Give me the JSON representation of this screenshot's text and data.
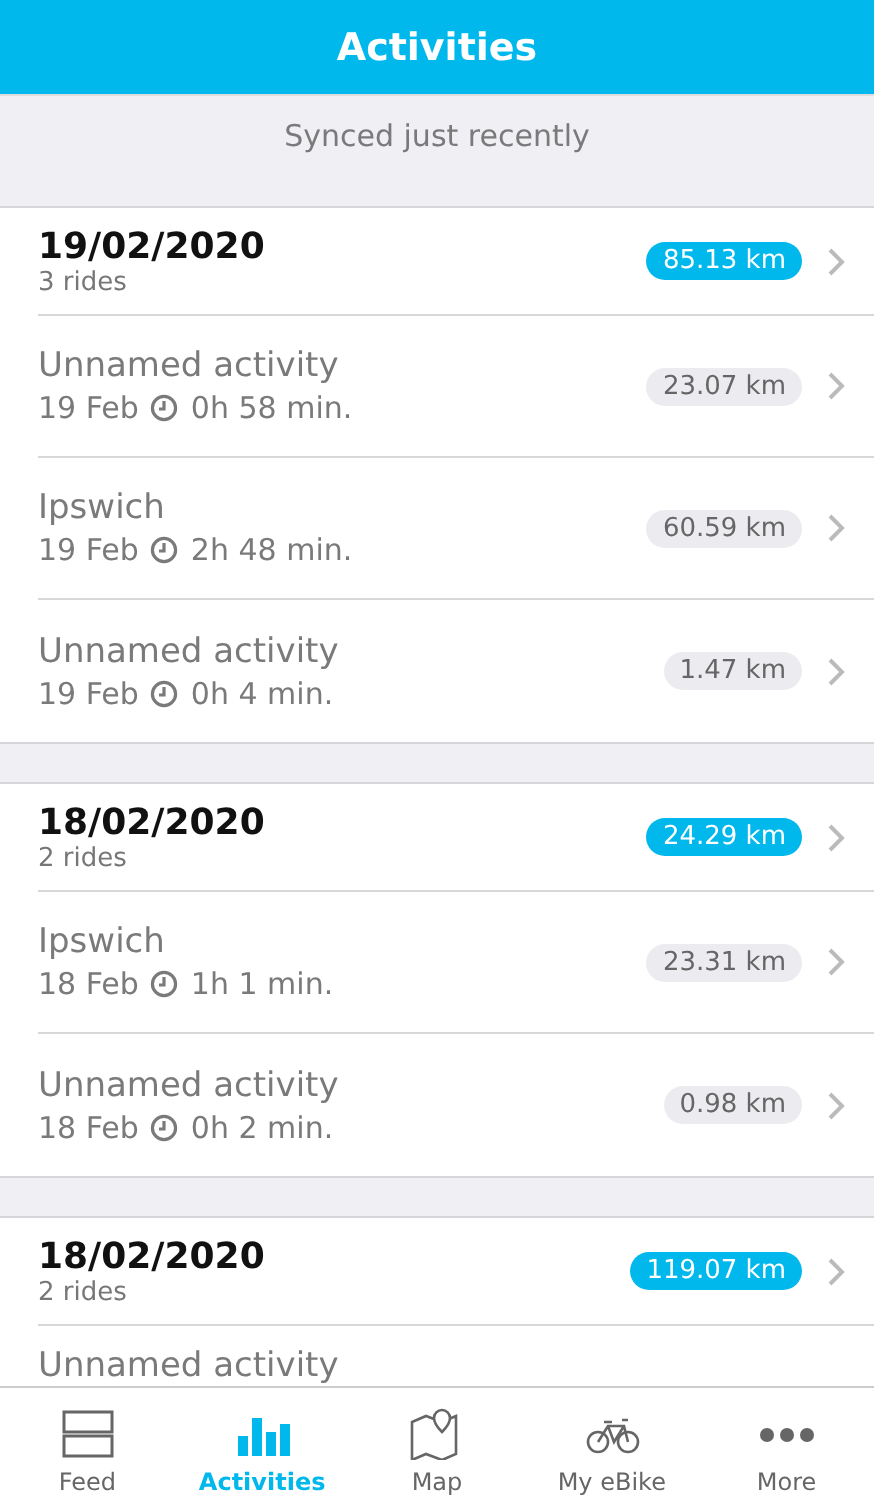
{
  "title": "Activities",
  "sync_status": "Synced just recently",
  "groups": [
    {
      "date": "19/02/2020",
      "rides": "3 rides",
      "distance": "85.13 km",
      "activities": [
        {
          "name": "Unnamed activity",
          "date": "19 Feb",
          "duration": "0h 58 min.",
          "distance": "23.07 km"
        },
        {
          "name": "Ipswich",
          "date": "19 Feb",
          "duration": "2h 48 min.",
          "distance": "60.59 km"
        },
        {
          "name": "Unnamed activity",
          "date": "19 Feb",
          "duration": "0h 4 min.",
          "distance": "1.47 km"
        }
      ]
    },
    {
      "date": "18/02/2020",
      "rides": "2 rides",
      "distance": "24.29 km",
      "activities": [
        {
          "name": "Ipswich",
          "date": "18 Feb",
          "duration": "1h 1 min.",
          "distance": "23.31 km"
        },
        {
          "name": "Unnamed activity",
          "date": "18 Feb",
          "duration": "0h 2 min.",
          "distance": "0.98 km"
        }
      ]
    },
    {
      "date": "18/02/2020",
      "rides": "2 rides",
      "distance": "119.07 km",
      "activities": [
        {
          "name": "Unnamed activity"
        }
      ]
    }
  ],
  "tabs": [
    {
      "label": "Feed",
      "selected": false
    },
    {
      "label": "Activities",
      "selected": true
    },
    {
      "label": "Map",
      "selected": false
    },
    {
      "label": "My eBike",
      "selected": false
    },
    {
      "label": "More",
      "selected": false
    }
  ]
}
